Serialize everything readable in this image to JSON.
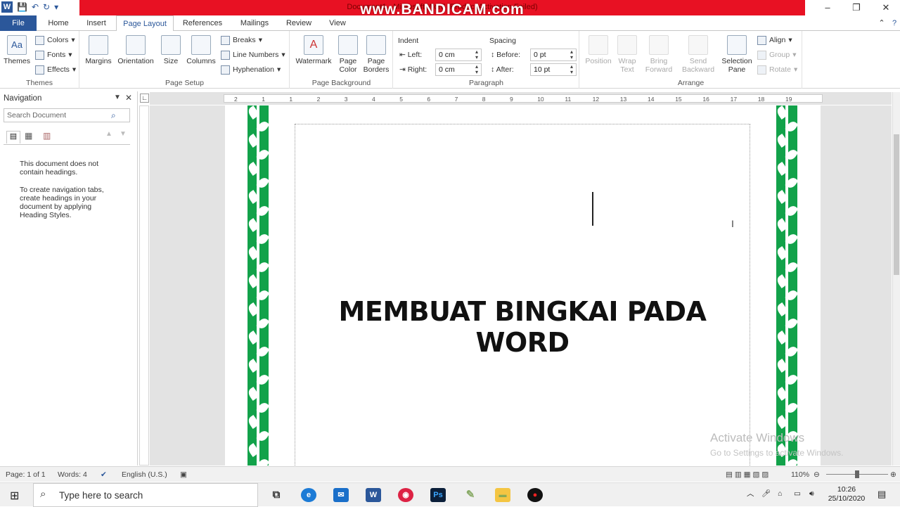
{
  "window": {
    "doc_title": "Document1 - Microsoft Word (Product Activation Failed)",
    "overlay_watermark": "www.BANDICAM.com",
    "controls": [
      "–",
      "❐",
      "✕"
    ]
  },
  "qat": {
    "save_icon": "save-icon",
    "undo_icon": "undo-icon",
    "redo_icon": "redo-icon"
  },
  "tabs": [
    "File",
    "Home",
    "Insert",
    "Page Layout",
    "References",
    "Mailings",
    "Review",
    "View"
  ],
  "ribbon": {
    "themes": {
      "themes": "Themes",
      "colors": "Colors",
      "fonts": "Fonts",
      "effects": "Effects",
      "label": "Themes"
    },
    "page_setup": {
      "margins": "Margins",
      "orientation": "Orientation",
      "size": "Size",
      "columns": "Columns",
      "breaks": "Breaks",
      "line_numbers": "Line Numbers",
      "hyphenation": "Hyphenation",
      "label": "Page Setup"
    },
    "page_background": {
      "watermark": "Watermark",
      "page_color_1": "Page",
      "page_color_2": "Color",
      "page_borders_1": "Page",
      "page_borders_2": "Borders",
      "label": "Page Background"
    },
    "paragraph": {
      "indent": "Indent",
      "left": "Left:",
      "left_value": "0 cm",
      "right": "Right:",
      "right_value": "0 cm",
      "spacing": "Spacing",
      "before": "Before:",
      "before_value": "0 pt",
      "after": "After:",
      "after_value": "10 pt",
      "label": "Paragraph"
    },
    "arrange": {
      "position": "Position",
      "wrap_1": "Wrap",
      "wrap_2": "Text",
      "bring_1": "Bring",
      "bring_2": "Forward",
      "send_1": "Send",
      "send_2": "Backward",
      "sel_1": "Selection",
      "sel_2": "Pane",
      "align": "Align",
      "group": "Group",
      "rotate": "Rotate",
      "label": "Arrange"
    }
  },
  "navigation": {
    "title": "Navigation",
    "search_placeholder": "Search Document",
    "msg1": "This document does not contain headings.",
    "msg2": "To create navigation tabs, create headings in your document by applying Heading Styles."
  },
  "ruler_ticks": [
    "2",
    "1",
    "1",
    "2",
    "3",
    "4",
    "5",
    "6",
    "7",
    "8",
    "9",
    "10",
    "11",
    "12",
    "13",
    "14",
    "15",
    "16",
    "17",
    "18",
    "19"
  ],
  "document": {
    "heading": "MEMBUAT BINGKAI PADA WORD"
  },
  "activation": {
    "line1": "Activate Windows",
    "line2": "Go to Settings to activate Windows."
  },
  "status": {
    "page": "Page: 1 of 1",
    "words": "Words: 4",
    "language": "English (U.S.)",
    "zoom": "110%"
  },
  "taskbar": {
    "search_placeholder": "Type here to search",
    "time": "10:26",
    "date": "25/10/2020"
  }
}
